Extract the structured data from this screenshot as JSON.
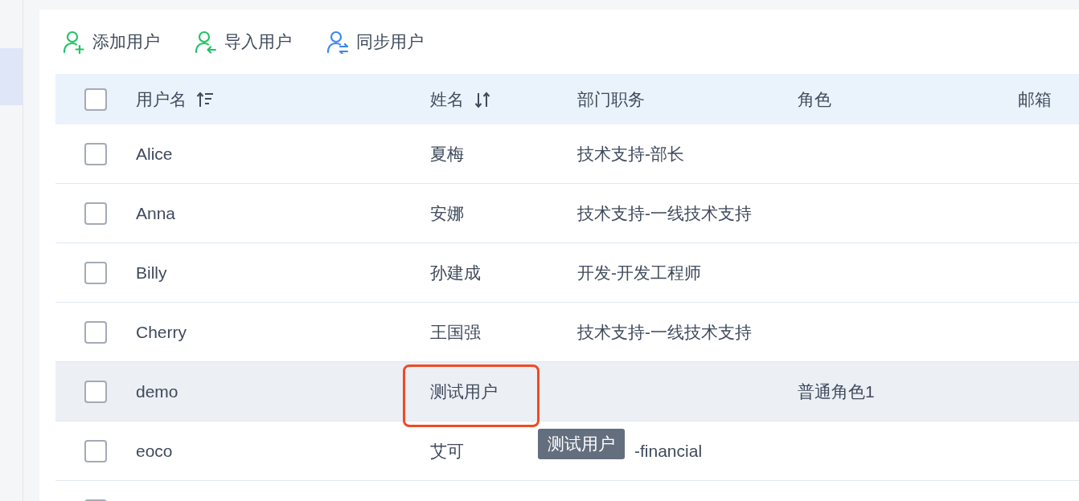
{
  "sidebar": {
    "items": [
      {
        "selected": true
      }
    ]
  },
  "toolbar": [
    {
      "label": "添加用户",
      "kind": "add"
    },
    {
      "label": "导入用户",
      "kind": "import"
    },
    {
      "label": "同步用户",
      "kind": "sync"
    }
  ],
  "table": {
    "header_checked": false,
    "columns": [
      {
        "label": "用户名",
        "kind": "sortasc"
      },
      {
        "label": "姓名",
        "kind": "sortboth"
      },
      {
        "label": "部门职务",
        "kind": "plain"
      },
      {
        "label": "角色",
        "kind": "plain"
      },
      {
        "label": "邮箱",
        "kind": "plain"
      }
    ],
    "rows": [
      {
        "checked": false,
        "username": "Alice",
        "name": "夏梅",
        "dept": "技术支持-部长",
        "hovered": false,
        "annotated": false,
        "dept_covered": false
      },
      {
        "checked": false,
        "username": "Anna",
        "name": "安娜",
        "dept": "技术支持-一线技术支持",
        "hovered": false,
        "annotated": false,
        "dept_covered": false
      },
      {
        "checked": false,
        "username": "Billy",
        "name": "孙建成",
        "dept": "开发-开发工程师",
        "hovered": false,
        "annotated": false,
        "dept_covered": false
      },
      {
        "checked": false,
        "username": "Cherry",
        "name": "王国强",
        "dept": "技术支持-一线技术支持",
        "hovered": false,
        "annotated": false,
        "dept_covered": false
      },
      {
        "checked": false,
        "username": "demo",
        "name": "测试用户",
        "role": "普通角色1",
        "hovered": true,
        "annotated": true,
        "dept_covered": false
      },
      {
        "checked": false,
        "username": "eoco",
        "name": "艾可",
        "dept": "-financial",
        "hovered": false,
        "annotated": false,
        "dept_covered": true
      },
      {
        "checked": false,
        "hovered": false,
        "annotated": false,
        "dept_covered": false
      }
    ]
  },
  "tooltip": {
    "text": "测试用户"
  }
}
